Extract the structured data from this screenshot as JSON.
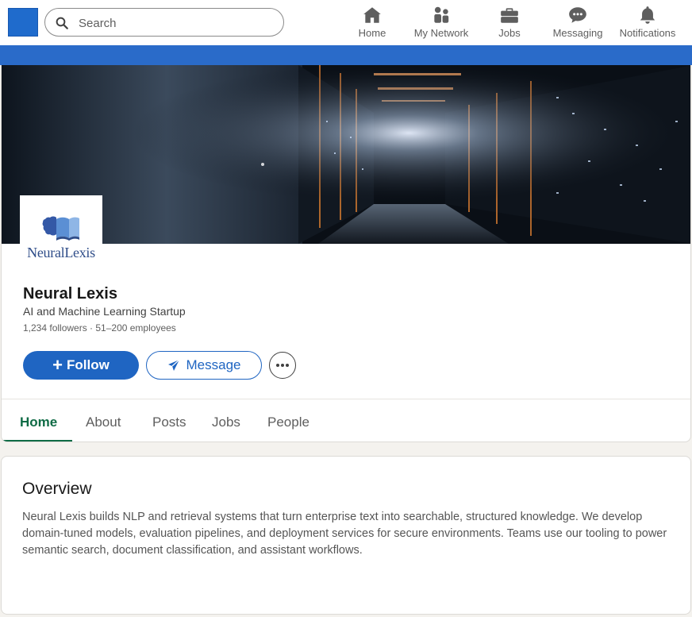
{
  "nav": {
    "search_placeholder": "Search",
    "items": [
      {
        "label": "Home",
        "icon": "home-icon"
      },
      {
        "label": "My Network",
        "icon": "network-icon"
      },
      {
        "label": "Jobs",
        "icon": "briefcase-icon"
      },
      {
        "label": "Messaging",
        "icon": "chat-icon"
      },
      {
        "label": "Notifications",
        "icon": "bell-icon"
      }
    ]
  },
  "company": {
    "logo_wordmark": "NeuralLexis",
    "name": "Neural Lexis",
    "tagline": "AI and Machine Learning Startup",
    "meta": "1,234 followers · 51–200 employees"
  },
  "actions": {
    "follow_label": "Follow",
    "message_label": "Message"
  },
  "tabs": [
    {
      "label": "Home",
      "active": true
    },
    {
      "label": "About"
    },
    {
      "label": "Posts"
    },
    {
      "label": "Jobs"
    },
    {
      "label": "People"
    }
  ],
  "overview": {
    "title": "Overview",
    "text": "Neural Lexis builds NLP and retrieval systems that turn enterprise text into searchable, structured knowledge. We develop domain-tuned models, evaluation pipelines, and deployment services for secure environments. Teams use our tooling to power semantic search, document classification, and assistant workflows."
  },
  "colors": {
    "brand_blue": "#1f65c2",
    "active_tab": "#0f6b45",
    "banner_blue": "#2a6bc9"
  }
}
